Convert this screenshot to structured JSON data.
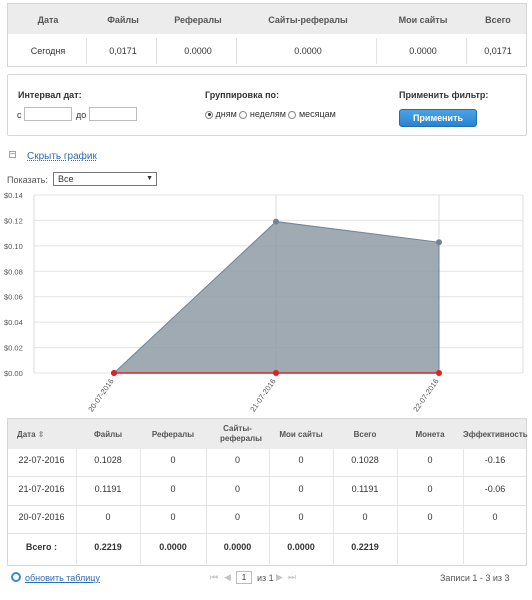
{
  "summary": {
    "headers": [
      "Дата",
      "Файлы",
      "Рефералы",
      "Сайты-рефералы",
      "Мои сайты",
      "Всего"
    ],
    "values": [
      "Сегодня",
      "0,0171",
      "0.0000",
      "0.0000",
      "0.0000",
      "0,0171"
    ]
  },
  "filter": {
    "interval_label": "Интервал дат:",
    "from_label": "с",
    "to_label": "до",
    "from_value": "",
    "to_value": "",
    "grouping_label": "Группировка по:",
    "group_options": [
      "дням",
      "неделям",
      "месяцам"
    ],
    "selected_group": "дням",
    "apply_filter_label": "Применить фильтр:",
    "apply_button": "Применить"
  },
  "chart_toggle": {
    "icon": "minus-icon",
    "label": "Скрыть график"
  },
  "show": {
    "label": "Показать:",
    "selected": "Все"
  },
  "chart_data": {
    "type": "area",
    "x": [
      "20-07-2016",
      "21-07-2016",
      "22-07-2016"
    ],
    "series": [
      {
        "values": [
          0,
          0.1191,
          0.1028
        ],
        "color": "#8e9ba6"
      },
      {
        "values": [
          0,
          0,
          0
        ],
        "color": "#e02020"
      }
    ],
    "yticks": [
      "$0.14",
      "$0.12",
      "$0.10",
      "$0.08",
      "$0.06",
      "$0.04",
      "$0.02",
      "$0.00"
    ],
    "ylim": [
      0,
      0.14
    ],
    "grid": true
  },
  "table": {
    "headers": [
      "Дата",
      "Файлы",
      "Рефералы",
      "Сайты-рефералы",
      "Мои сайты",
      "Всего",
      "Монета",
      "Эффективность"
    ],
    "rows": [
      [
        "22-07-2016",
        "0.1028",
        "0",
        "0",
        "0",
        "0.1028",
        "0",
        "-0.16"
      ],
      [
        "21-07-2016",
        "0.1191",
        "0",
        "0",
        "0",
        "0.1191",
        "0",
        "-0.06"
      ],
      [
        "20-07-2016",
        "0",
        "0",
        "0",
        "0",
        "0",
        "0",
        "0"
      ]
    ],
    "totals_label": "Всего :",
    "totals": [
      "0.2219",
      "0.0000",
      "0.0000",
      "0.0000",
      "0.2219"
    ]
  },
  "footer": {
    "refresh_label": "обновить таблицу",
    "page": "1",
    "of_label": "из 1",
    "records": "Записи 1 - 3 из 3"
  }
}
